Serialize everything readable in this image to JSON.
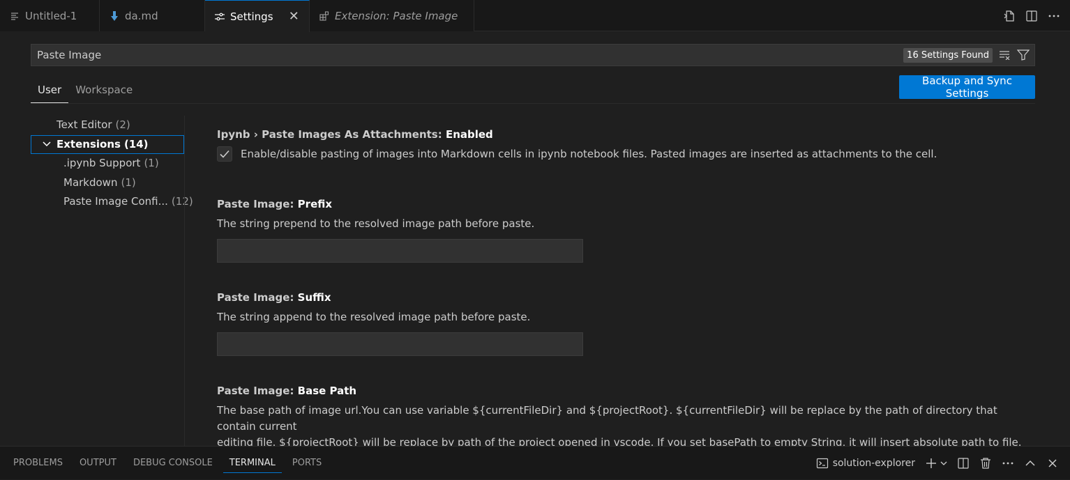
{
  "tabs": [
    {
      "label": "Untitled-1",
      "icon": "lines-icon",
      "active": false,
      "preview": false
    },
    {
      "label": "da.md",
      "icon": "markdown-down-arrow-icon",
      "active": false,
      "preview": false
    },
    {
      "label": "Settings",
      "icon": "settings-sliders-icon",
      "active": true,
      "preview": false,
      "close": "✕"
    },
    {
      "label": "Extension: Paste Image",
      "icon": "extensions-icon",
      "active": false,
      "preview": true
    }
  ],
  "editor_actions": [
    "open-settings-json-icon",
    "split-editor-icon",
    "more-actions-icon"
  ],
  "search": {
    "value": "Paste Image",
    "results_badge": "16 Settings Found",
    "icons": [
      "clear-filter-icon",
      "filter-icon"
    ]
  },
  "scope_tabs": {
    "user": "User",
    "workspace": "Workspace"
  },
  "sync_button": "Backup and Sync Settings",
  "toc": {
    "text_editor": {
      "label": "Text Editor",
      "count": "(2)"
    },
    "extensions": {
      "label": "Extensions",
      "count": "(14)"
    },
    "ipynb": {
      "label": ".ipynb Support",
      "count": "(1)"
    },
    "markdown": {
      "label": "Markdown",
      "count": "(1)"
    },
    "paste_image": {
      "label": "Paste Image Confi...",
      "count": "(12)"
    }
  },
  "settings": {
    "attachments": {
      "category": "Ipynb › Paste Images As Attachments: ",
      "key": "Enabled",
      "description": "Enable/disable pasting of images into Markdown cells in ipynb notebook files. Pasted images are inserted as attachments to the cell.",
      "checked": true
    },
    "prefix": {
      "category": "Paste Image: ",
      "key": "Prefix",
      "description": "The string prepend to the resolved image path before paste.",
      "value": ""
    },
    "suffix": {
      "category": "Paste Image: ",
      "key": "Suffix",
      "description": "The string append to the resolved image path before paste.",
      "value": ""
    },
    "base_path": {
      "category": "Paste Image: ",
      "key": "Base Path",
      "description_line1": "The base path of image url.You can use variable ${currentFileDir} and ${projectRoot}. ${currentFileDir} will be replace by the path of directory that contain current",
      "description_line2": "editing file. ${projectRoot} will be replace by path of the project opened in vscode. If you set basePath to empty String, it will insert absolute path to file."
    }
  },
  "panel": {
    "tabs": {
      "problems": "PROBLEMS",
      "output": "OUTPUT",
      "debug_console": "DEBUG CONSOLE",
      "terminal": "TERMINAL",
      "ports": "PORTS"
    },
    "active_tab": "TERMINAL",
    "terminal_name": "solution-explorer",
    "actions": [
      "new-terminal-icon",
      "terminal-dropdown-icon",
      "split-terminal-icon",
      "kill-terminal-icon",
      "more-actions-icon",
      "maximize-panel-icon",
      "close-panel-icon"
    ]
  },
  "colors": {
    "accent": "#0078d4",
    "editor_bg": "#1f1f1f",
    "tabbar_bg": "#181818"
  }
}
